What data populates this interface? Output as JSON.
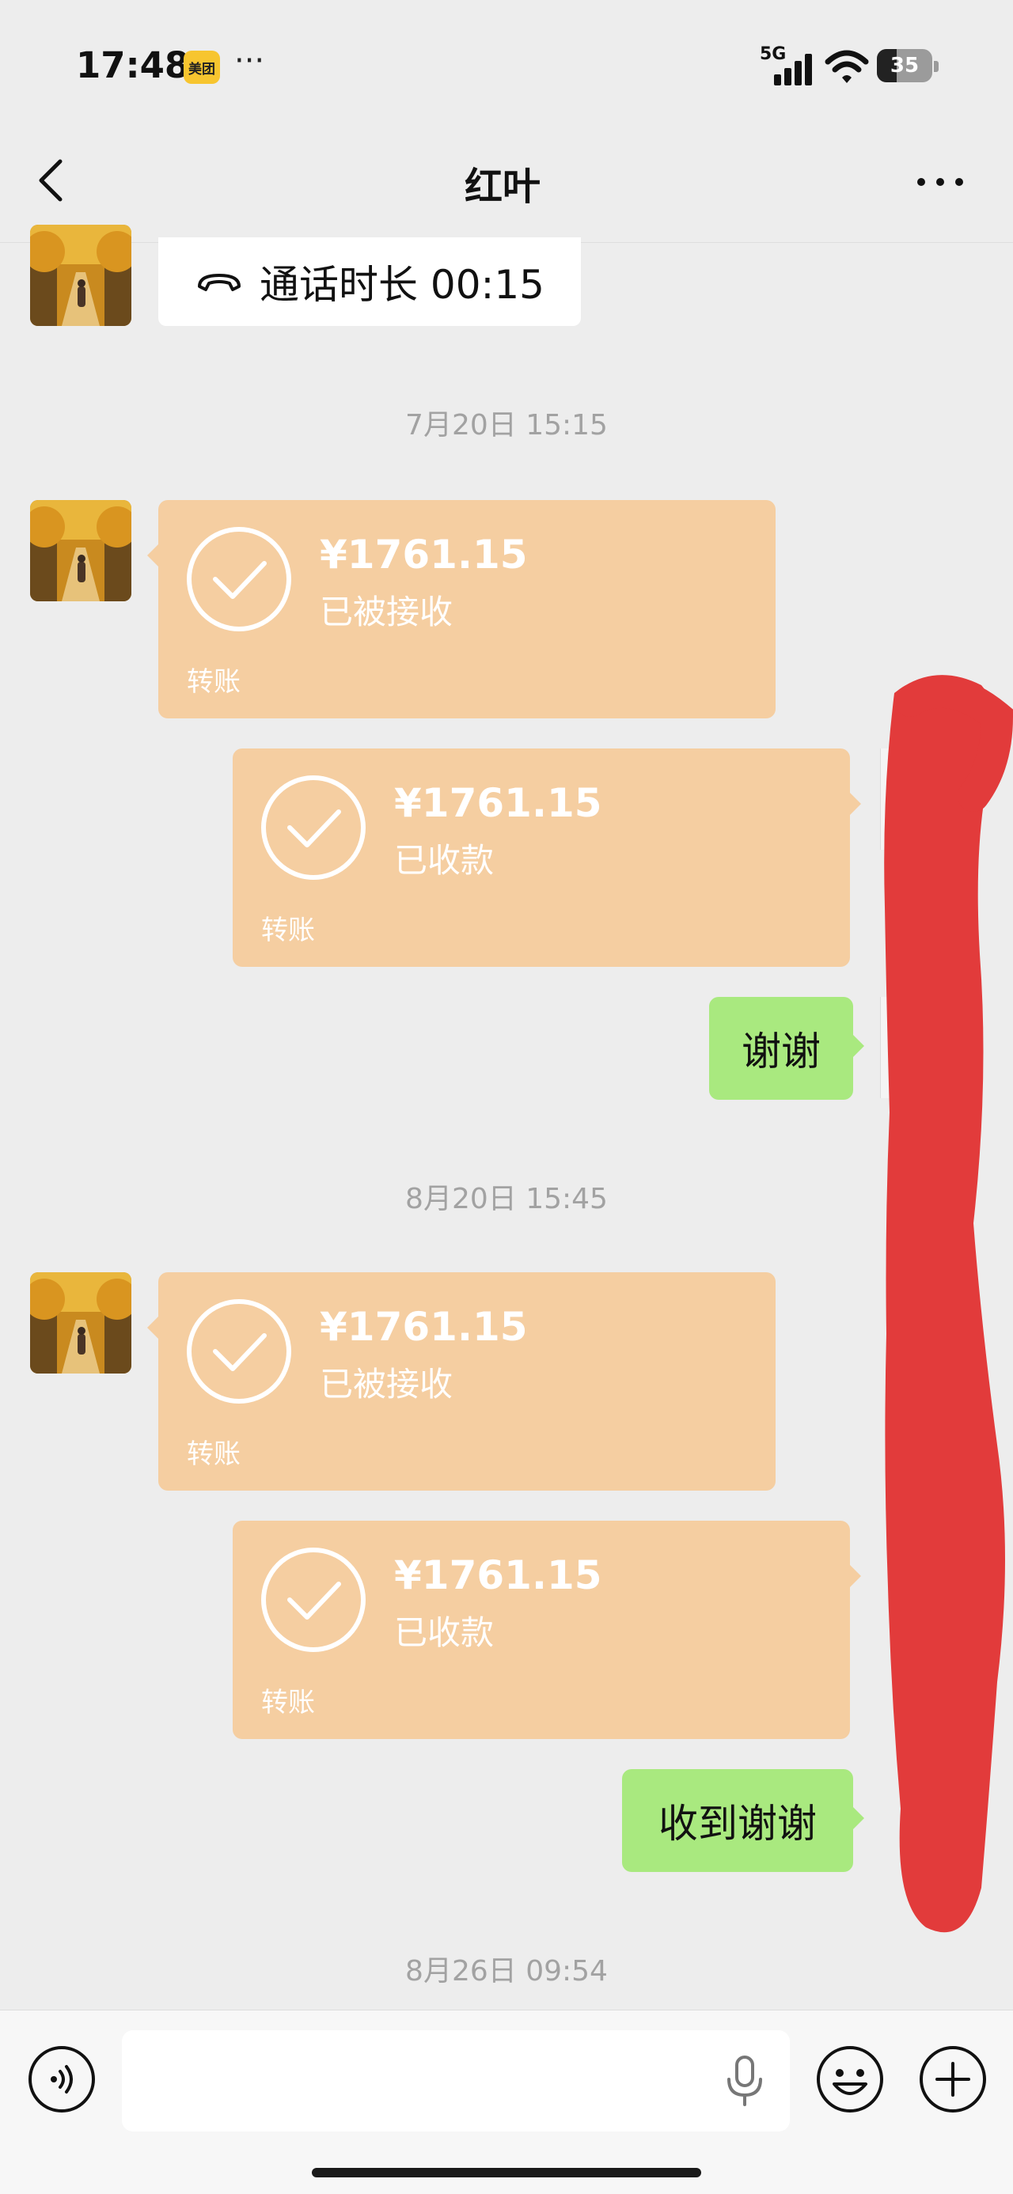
{
  "status_bar": {
    "time": "17:48",
    "app_badge": "美团",
    "more": "···",
    "network": "5G",
    "battery": "35"
  },
  "nav": {
    "title": "红叶",
    "back_icon": "chevron-left-icon",
    "more_icon": "more-dots-icon"
  },
  "messages": {
    "call": {
      "text": "通话时长 00:15",
      "icon": "phone-hangup-icon"
    },
    "ts1": "7月20日 15:15",
    "t1": {
      "amount": "¥1761.15",
      "status": "已被接收",
      "footer": "转账"
    },
    "t2": {
      "amount": "¥1761.15",
      "status": "已收款",
      "footer": "转账"
    },
    "reply1": "谢谢",
    "ts2": "8月20日 15:45",
    "t3": {
      "amount": "¥1761.15",
      "status": "已被接收",
      "footer": "转账"
    },
    "t4": {
      "amount": "¥1761.15",
      "status": "已收款",
      "footer": "转账"
    },
    "reply2": "收到谢谢",
    "ts3": "8月26日 09:54"
  },
  "input_bar": {
    "voice_icon": "voice-icon",
    "mic_icon": "mic-icon",
    "emoji_icon": "emoji-icon",
    "plus_icon": "plus-icon"
  },
  "colors": {
    "transfer_bg": "#f5cea1",
    "self_bubble": "#a9e97f",
    "background": "#ededed",
    "redaction": "#e23b3b"
  }
}
